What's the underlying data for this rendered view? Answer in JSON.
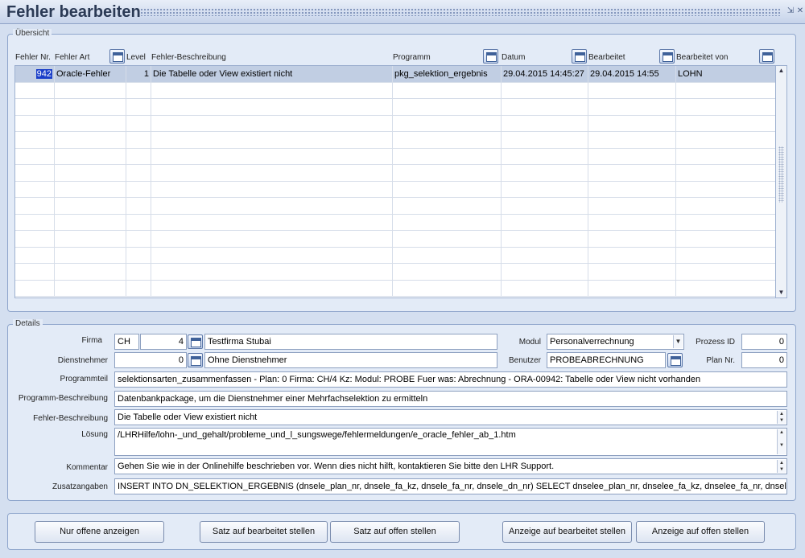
{
  "window": {
    "title": "Fehler bearbeiten",
    "min_icon": "minimize-icon",
    "close_icon": "close-icon"
  },
  "overview": {
    "label": "Übersicht",
    "columns": {
      "fehler_nr": "Fehler Nr.",
      "fehler_art": "Fehler Art",
      "level": "Level",
      "beschreibung": "Fehler-Beschreibung",
      "programm": "Programm",
      "datum": "Datum",
      "bearbeitet": "Bearbeitet",
      "bearbeitet_von": "Bearbeitet von"
    },
    "rows": [
      {
        "fehler_nr": "942",
        "fehler_art": "Oracle-Fehler",
        "level": "1",
        "beschreibung": "Die Tabelle oder View existiert nicht",
        "programm": "pkg_selektion_ergebnis",
        "datum": "29.04.2015 14:45:27",
        "bearbeitet": "29.04.2015 14:55",
        "bearbeitet_von": "LOHN"
      }
    ]
  },
  "details": {
    "label": "Details",
    "firma": {
      "label": "Firma",
      "code": "CH",
      "number": "4",
      "name": "Testfirma Stubai"
    },
    "modul": {
      "label": "Modul",
      "value": "Personalverrechnung"
    },
    "prozess_id": {
      "label": "Prozess ID",
      "value": "0"
    },
    "dienstnehmer": {
      "label": "Dienstnehmer",
      "number": "0",
      "name": "Ohne Dienstnehmer"
    },
    "benutzer": {
      "label": "Benutzer",
      "value": "PROBEABRECHNUNG"
    },
    "plan_nr": {
      "label": "Plan Nr.",
      "value": "0"
    },
    "programmteil": {
      "label": "Programmteil",
      "value": "selektionsarten_zusammenfassen - Plan: 0 Firma: CH/4 Kz:  Modul: PROBE Fuer was: Abrechnung - ORA-00942: Tabelle oder View nicht vorhanden"
    },
    "programm_beschreibung": {
      "label": "Programm-Beschreibung",
      "value": "Datenbankpackage, um die Dienstnehmer einer Mehrfachselektion zu ermitteln"
    },
    "fehler_beschreibung": {
      "label": "Fehler-Beschreibung",
      "value": "Die Tabelle oder View existiert nicht"
    },
    "loesung": {
      "label": "Lösung",
      "value": "/LHRHilfe/lohn-_und_gehalt/probleme_und_l_sungswege/fehlermeldungen/e_oracle_fehler_ab_1.htm"
    },
    "kommentar": {
      "label": "Kommentar",
      "value": "Gehen Sie wie in der Onlinehilfe beschrieben vor. Wenn dies nicht hilft, kontaktieren Sie bitte den LHR Support."
    },
    "zusatzangaben": {
      "label": "Zusatzangaben",
      "value": "INSERT INTO DN_SELEKTION_ERGEBNIS (dnsele_plan_nr, dnsele_fa_kz, dnsele_fa_nr, dnsele_dn_nr) SELECT dnselee_plan_nr, dnselee_fa_kz, dnselee_fa_nr, dnselee_dn_nr FROM"
    }
  },
  "buttons": {
    "nur_offene": "Nur offene anzeigen",
    "satz_bearbeitet": "Satz auf bearbeitet stellen",
    "satz_offen": "Satz auf offen stellen",
    "anzeige_bearbeitet": "Anzeige auf bearbeitet stellen",
    "anzeige_offen": "Anzeige auf offen stellen"
  },
  "colors": {
    "selection": "#1a3ec9",
    "row_selected": "#c1cee3",
    "background": "#d4dff0"
  }
}
